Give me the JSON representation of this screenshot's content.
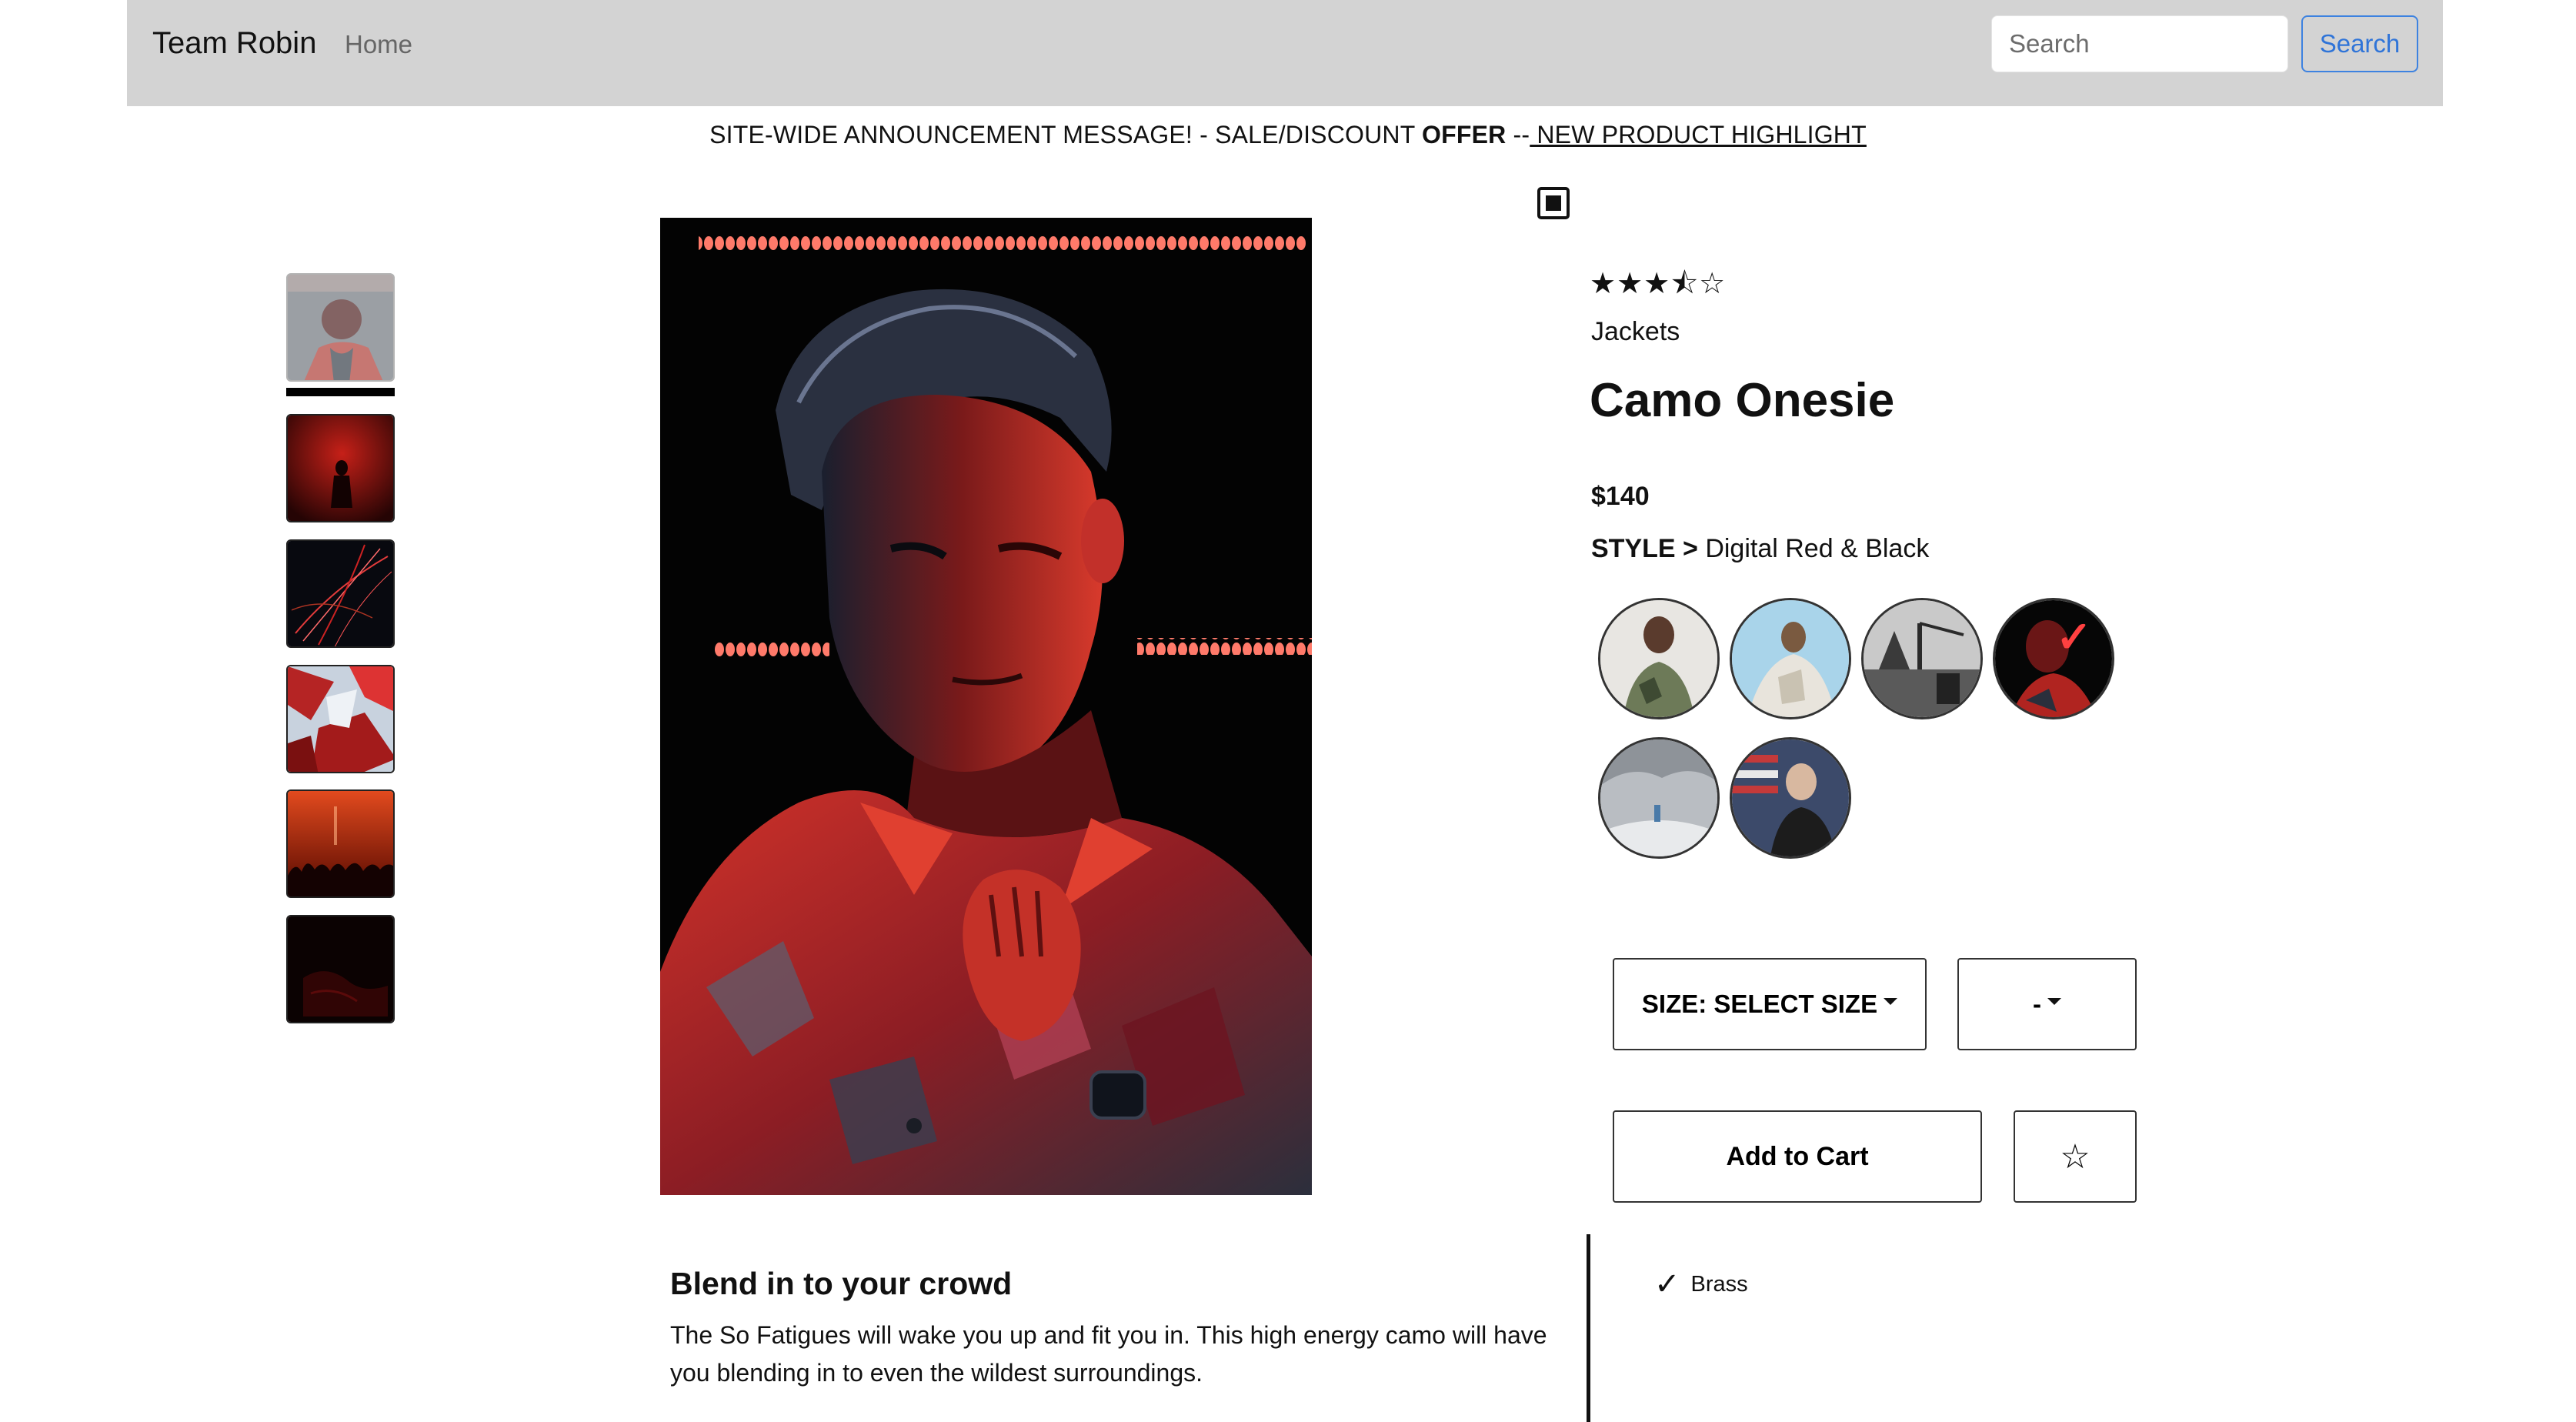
{
  "navbar": {
    "brand": "Team Robin",
    "home": "Home",
    "search_placeholder": "Search",
    "search_button": "Search"
  },
  "announcement": {
    "part1": "SITE-WIDE ANNOUNCEMENT MESSAGE! - SALE/DISCOUNT ",
    "offer": "OFFER",
    "sep": " --",
    "link": " NEW PRODUCT HIGHLIGHT"
  },
  "thumbnails": [
    "thumb-portrait",
    "thumb-silhouette",
    "thumb-light-trails",
    "thumb-abstract",
    "thumb-concert",
    "thumb-dark"
  ],
  "product": {
    "rating": 3.5,
    "rating_max": 5,
    "stars": "★★★⯪☆",
    "category": "Jackets",
    "name": "Camo Onesie",
    "price": "$140",
    "style_label": "STYLE >",
    "style_value": "Digital Red & Black",
    "selected_style_index": 3
  },
  "controls": {
    "size_label": "SIZE: SELECT SIZE",
    "qty_label": "-",
    "add_to_cart": "Add to Cart",
    "favorite_icon": "☆"
  },
  "description": {
    "heading": "Blend in to your crowd",
    "text": "The So Fatigues will wake you up and fit you in. This high energy camo will have you blending in to even the wildest surroundings."
  },
  "features": [
    {
      "check": "✓",
      "label": "Brass"
    }
  ],
  "colors": {
    "navbar_bg": "#d3d3d3",
    "accent_blue": "#2f74d8",
    "image_red": "#e0392b",
    "selected_check": "#ff4040"
  }
}
